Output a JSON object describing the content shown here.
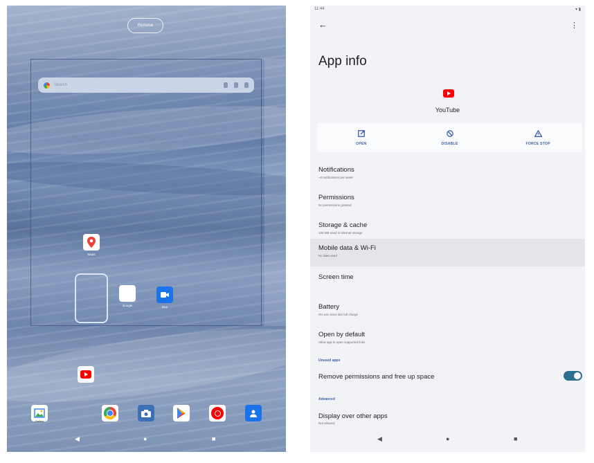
{
  "home": {
    "remove_label": "Remove",
    "search_placeholder": "Search",
    "apps": {
      "maps": {
        "label": "Maps"
      },
      "google": {
        "label": "Google"
      },
      "duo": {
        "label": "Duo"
      }
    },
    "dock_gallery_label": "Gallery",
    "nav": {
      "back": "◀",
      "home": "●",
      "recents": "■"
    }
  },
  "settings": {
    "status": {
      "time": "11:44",
      "icons": "▾ ▮"
    },
    "back_glyph": "←",
    "more_glyph": "⋮",
    "title": "App info",
    "app_name": "YouTube",
    "actions": {
      "open": "OPEN",
      "disable": "DISABLE",
      "force_stop": "FORCE STOP"
    },
    "rows": {
      "notifications": {
        "title": "Notifications",
        "sub": "~0 notifications per week"
      },
      "permissions": {
        "title": "Permissions",
        "sub": "No permissions granted"
      },
      "storage": {
        "title": "Storage & cache",
        "sub": "109 MB used in internal storage"
      },
      "mobile_data": {
        "title": "Mobile data & Wi-Fi",
        "sub": "No data used"
      },
      "screen_time": {
        "title": "Screen time"
      },
      "battery": {
        "title": "Battery",
        "sub": "0% use since last full charge"
      },
      "open_default": {
        "title": "Open by default",
        "sub": "Allow app to open supported links"
      },
      "remove_permissions": {
        "title": "Remove permissions and free up space"
      },
      "display_over": {
        "title": "Display over other apps",
        "sub": "Not allowed"
      }
    },
    "sections": {
      "unused": "Unused apps",
      "advanced": "Advanced"
    },
    "toggle_on": true,
    "nav": {
      "back": "◀",
      "home": "●",
      "recents": "■"
    }
  },
  "colors": {
    "accent": "#3a5fa8",
    "toggle": "#2d6f8e",
    "youtube_red": "#ff0000"
  }
}
